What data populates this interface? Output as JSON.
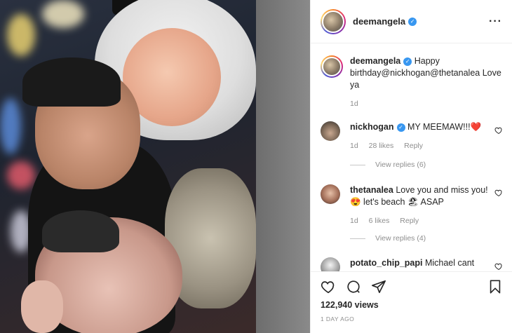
{
  "post": {
    "username": "deemangela",
    "more_icon": "more-horizontal-icon"
  },
  "caption": {
    "username": "deemangela",
    "text": "Happy birthday@nickhogan@thetanalea Love ya",
    "time": "1d"
  },
  "comments": [
    {
      "username": "nickhogan",
      "text": "MY MEEMAW!!!❤️",
      "time": "1d",
      "likes": "28 likes",
      "reply": "Reply",
      "view_replies": "View replies (6)"
    },
    {
      "username": "thetanalea",
      "text": "Love you and miss you! 😍 let's beach 🏖 ASAP",
      "time": "1d",
      "likes": "6 likes",
      "reply": "Reply",
      "view_replies": "View replies (4)"
    },
    {
      "username": "potato_chip_papi",
      "text": "Michael cant"
    }
  ],
  "footer": {
    "views": "122,940 views",
    "timestamp": "1 DAY AGO"
  },
  "colors": {
    "verified": "#3897f0",
    "muted_text": "#8e8e8e",
    "heart": "#ed4956"
  }
}
